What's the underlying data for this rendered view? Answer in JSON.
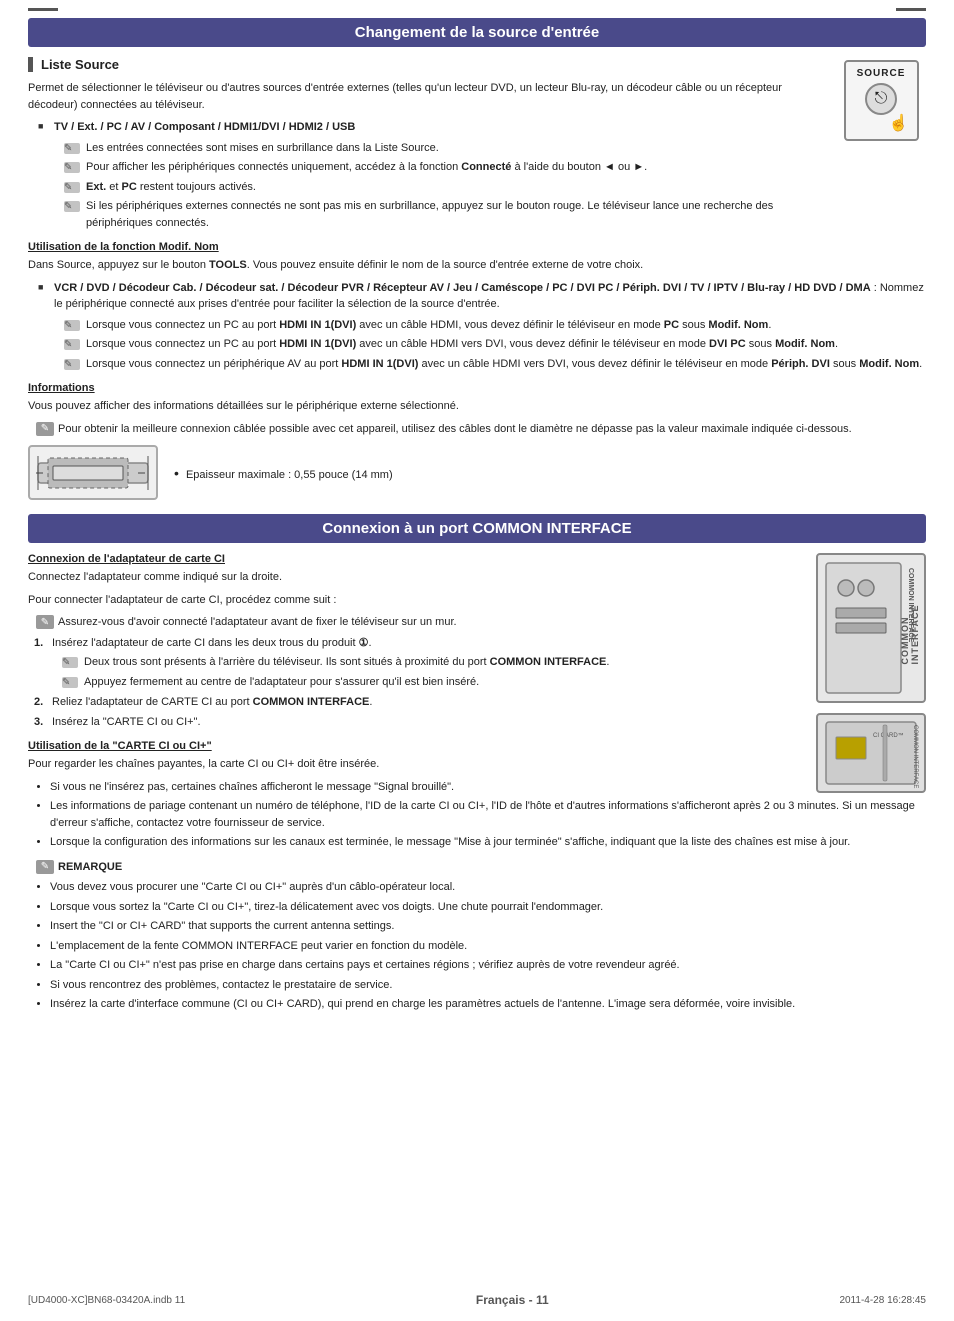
{
  "section1": {
    "header": "Changement de la source d'entrée",
    "subsection": "Liste Source",
    "intro": "Permet de sélectionner le téléviseur ou d'autres sources d'entrée externes (telles qu'un lecteur DVD, un lecteur Blu-ray, un décodeur câble ou un récepteur décodeur) connectées au téléviseur.",
    "bullet_main": "TV / Ext. / PC / AV / Composant / HDMI1/DVI / HDMI2 / USB",
    "notes": [
      "Les entrées connectées sont mises en surbrillance dans la Liste Source.",
      "Pour afficher les périphériques connectés uniquement, accédez à la fonction Connecté à l'aide du bouton ◄ ou ►.",
      "Ext. et PC restent toujours activés.",
      "Si les périphériques externes connectés ne sont pas mis en surbrillance, appuyez sur le bouton rouge. Le téléviseur lance une recherche des périphériques connectés."
    ],
    "source_label": "SOURCE",
    "utilisation_heading": "Utilisation de la fonction Modif. Nom",
    "utilisation_text": "Dans Source, appuyez sur le bouton TOOLS. Vous pouvez ensuite définir le nom de la source d'entrée externe de votre choix.",
    "bullet_main2": "VCR / DVD / Décodeur Cab. / Décodeur sat. / Décodeur PVR / Récepteur AV / Jeu / Caméscope / PC / DVI PC / Périph. DVI / TV / IPTV / Blu-ray / HD DVD / DMA",
    "bullet_main2_suffix": ": Nommez le périphérique connecté aux prises d'entrée pour faciliter la sélection de la source d'entrée.",
    "notes2": [
      "Lorsque vous connectez un PC au port HDMI IN 1(DVI) avec un câble HDMI, vous devez définir le téléviseur en mode PC sous Modif. Nom.",
      "Lorsque vous connectez un PC au port HDMI IN 1(DVI) avec un câble HDMI vers DVI, vous devez définir le téléviseur en mode DVI PC sous Modif. Nom.",
      "Lorsque vous connectez un périphérique AV au port HDMI IN 1(DVI) avec un câble HDMI vers DVI, vous devez définir le téléviseur en mode Périph. DVI sous Modif. Nom."
    ],
    "informations_heading": "Informations",
    "informations_text": "Vous pouvez afficher des informations détaillées sur le périphérique externe sélectionné.",
    "note_cable": "Pour obtenir la meilleure connexion câblée possible avec cet appareil, utilisez des câbles dont le diamètre ne dépasse pas la valeur maximale indiquée ci-dessous.",
    "thickness_text": "Epaisseur maximale : 0,55 pouce (14 mm)"
  },
  "section2": {
    "header": "Connexion à un port COMMON INTERFACE",
    "conn_heading": "Connexion de l'adaptateur de carte CI",
    "conn_text1": "Connectez l'adaptateur comme indiqué sur la droite.",
    "conn_text2": "Pour connecter l'adaptateur de carte CI, procédez comme suit :",
    "note_conn": "Assurez-vous d'avoir connecté l'adaptateur avant de fixer le téléviseur sur un mur.",
    "steps": [
      {
        "num": "1.",
        "text": "Insérez l'adaptateur de carte CI dans les deux trous du produit ①.",
        "subnotes": [
          "Deux trous sont présents à l'arrière du téléviseur. Ils sont situés à proximité du port COMMON INTERFACE.",
          "Appuyez fermement au centre de l'adaptateur pour s'assurer qu'il est bien inséré."
        ]
      },
      {
        "num": "2.",
        "text": "Reliez l'adaptateur de CARTE CI au port COMMON INTERFACE."
      },
      {
        "num": "3.",
        "text": "Insérez la \"CARTE CI ou CI+\"."
      }
    ],
    "util_ci_heading": "Utilisation de la \"CARTE CI ou CI+\"",
    "util_ci_text": "Pour regarder les chaînes payantes, la carte CI ou CI+ doit être insérée.",
    "util_ci_bullets": [
      "Si vous ne l'insérez pas, certaines chaînes afficheront le message \"Signal brouillé\".",
      "Les informations de pariage contenant un numéro de téléphone, l'ID de la carte CI ou CI+, l'ID de l'hôte et d'autres informations s'afficheront après 2 ou 3 minutes. Si un message d'erreur s'affiche, contactez votre fournisseur de service.",
      "Lorsque la configuration des informations sur les canaux est terminée, le message \"Mise à jour terminée\" s'affiche, indiquant que la liste des chaînes est mise à jour."
    ],
    "remarque_title": "REMARQUE",
    "remarque_bullets": [
      "Vous devez vous procurer une \"Carte CI ou CI+\" auprès d'un câblo-opérateur local.",
      "Lorsque vous sortez la \"Carte CI ou CI+\", tirez-la délicatement avec vos doigts. Une chute pourrait l'endommager.",
      "Insert the \"CI or CI+ CARD\" that supports the current antenna settings.",
      "L'emplacement de la fente COMMON INTERFACE peut varier en fonction du modèle.",
      "La \"Carte CI ou CI+\" n'est pas prise en charge dans certains pays et certaines régions ; vérifiez auprès de votre revendeur agréé.",
      "Si vous rencontrez des problèmes, contactez le prestataire de service.",
      "Insérez la carte d'interface commune (CI ou CI+ CARD), qui prend en charge les paramètres actuels de l'antenne. L'image sera déformée, voire invisible."
    ],
    "ci_box_label": "COMMON INTERFACE"
  },
  "footer": {
    "left": "[UD4000-XC]BN68-03420A.indb   11",
    "center": "Français - 11",
    "right": "2011-4-28   16:28:45"
  }
}
